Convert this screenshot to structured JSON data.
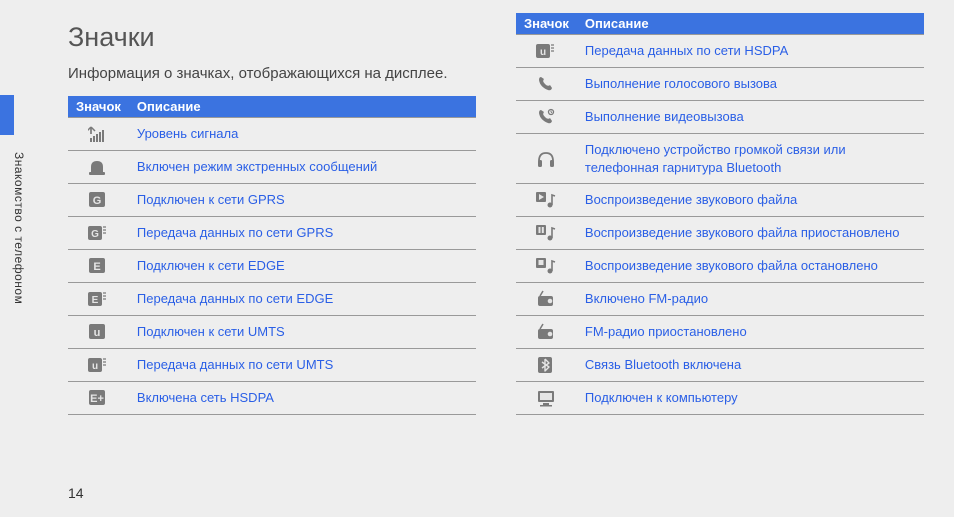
{
  "side_label": "Знакомство с телефоном",
  "title": "Значки",
  "intro": "Информация о значках, отображающихся на дисплее.",
  "headers": {
    "icon": "Значок",
    "desc": "Описание"
  },
  "left": [
    {
      "icon": "signal",
      "desc": "Уровень сигнала"
    },
    {
      "icon": "emergency",
      "desc": "Включен режим экстренных сообщений"
    },
    {
      "icon": "gprs",
      "desc": "Подключен к сети GPRS"
    },
    {
      "icon": "gprs-tx",
      "desc": "Передача данных по сети GPRS"
    },
    {
      "icon": "edge",
      "desc": "Подключен к сети EDGE"
    },
    {
      "icon": "edge-tx",
      "desc": "Передача данных по сети EDGE"
    },
    {
      "icon": "umts",
      "desc": "Подключен к сети UMTS"
    },
    {
      "icon": "umts-tx",
      "desc": "Передача данных по сети UMTS"
    },
    {
      "icon": "hsdpa-on",
      "desc": "Включена сеть HSDPA"
    }
  ],
  "right": [
    {
      "icon": "hsdpa-tx",
      "desc": "Передача данных по сети HSDPA"
    },
    {
      "icon": "call",
      "desc": "Выполнение голосового вызова"
    },
    {
      "icon": "video-call",
      "desc": "Выполнение видеовызова"
    },
    {
      "icon": "headphones",
      "desc": "Подключено устройство громкой связи или телефонная гарнитура Bluetooth"
    },
    {
      "icon": "play",
      "desc": "Воспроизведение звукового файла"
    },
    {
      "icon": "pause",
      "desc": "Воспроизведение звукового файла приостановлено"
    },
    {
      "icon": "stop",
      "desc": "Воспроизведение звукового файла остановлено"
    },
    {
      "icon": "fm-on",
      "desc": "Включено FM-радио"
    },
    {
      "icon": "fm-pause",
      "desc": "FM-радио приостановлено"
    },
    {
      "icon": "bluetooth",
      "desc": "Связь Bluetooth включена"
    },
    {
      "icon": "pc",
      "desc": "Подключен к компьютеру"
    }
  ],
  "page_number": "14"
}
